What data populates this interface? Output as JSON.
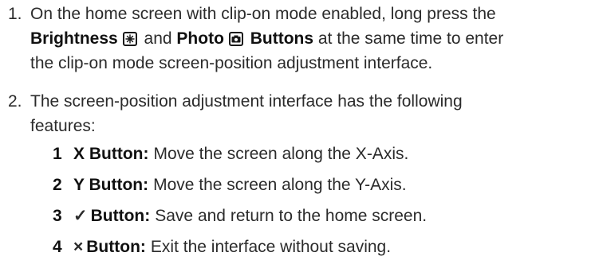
{
  "steps": [
    {
      "number": "1.",
      "line1": "On the home screen with clip-on mode enabled, long press the",
      "brightness_label": "Brightness",
      "and_text": "and",
      "photo_label": "Photo",
      "buttons_label": "Buttons",
      "line2_rest": "at the same time to enter",
      "line3": "the clip-on mode screen-position adjustment interface."
    },
    {
      "number": "2.",
      "line1": "The screen-position adjustment interface has the following",
      "line2": "features:"
    }
  ],
  "features": [
    {
      "number": "1",
      "glyph": "",
      "label": "X Button:",
      "desc": "Move the screen along the X-Axis."
    },
    {
      "number": "2",
      "glyph": "",
      "label": "Y Button:",
      "desc": "Move the screen along the Y-Axis."
    },
    {
      "number": "3",
      "glyph": "✓",
      "label": "Button:",
      "desc": "Save and return to the home screen."
    },
    {
      "number": "4",
      "glyph": "×",
      "label": "Button:",
      "desc": "Exit the interface without saving."
    }
  ],
  "icons": {
    "brightness": "brightness-icon",
    "photo": "camera-icon"
  }
}
